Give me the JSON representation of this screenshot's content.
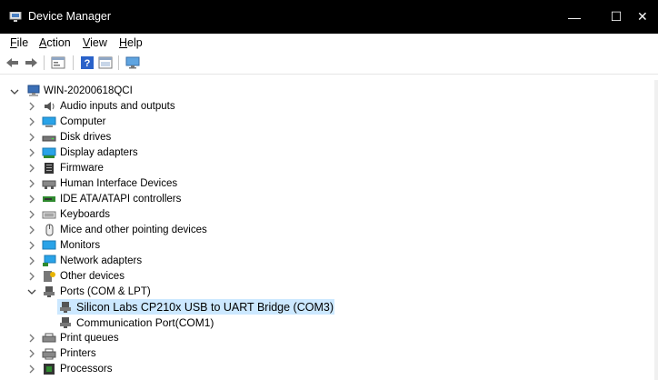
{
  "window": {
    "title": "Device Manager",
    "minimize_label": "—",
    "maximize_label": "☐",
    "close_label": "✕"
  },
  "menu": [
    {
      "label": "File",
      "accel": "F",
      "rest": "ile"
    },
    {
      "label": "Action",
      "accel": "A",
      "rest": "ction"
    },
    {
      "label": "View",
      "accel": "V",
      "rest": "iew"
    },
    {
      "label": "Help",
      "accel": "H",
      "rest": "elp"
    }
  ],
  "toolbar": [
    "back-icon",
    "forward-icon",
    "properties-icon",
    "help-icon",
    "show-hidden-icon",
    "scan-hardware-icon"
  ],
  "tree": {
    "root": "WIN-20200618QCI",
    "categories": [
      "Audio inputs and outputs",
      "Computer",
      "Disk drives",
      "Display adapters",
      "Firmware",
      "Human Interface Devices",
      "IDE ATA/ATAPI controllers",
      "Keyboards",
      "Mice and other pointing devices",
      "Monitors",
      "Network adapters",
      "Other devices",
      "Ports (COM & LPT)",
      "Print queues",
      "Printers",
      "Processors"
    ],
    "ports_children": [
      "Silicon Labs CP210x USB to UART Bridge (COM3)",
      "Communication Port(COM1)"
    ]
  }
}
